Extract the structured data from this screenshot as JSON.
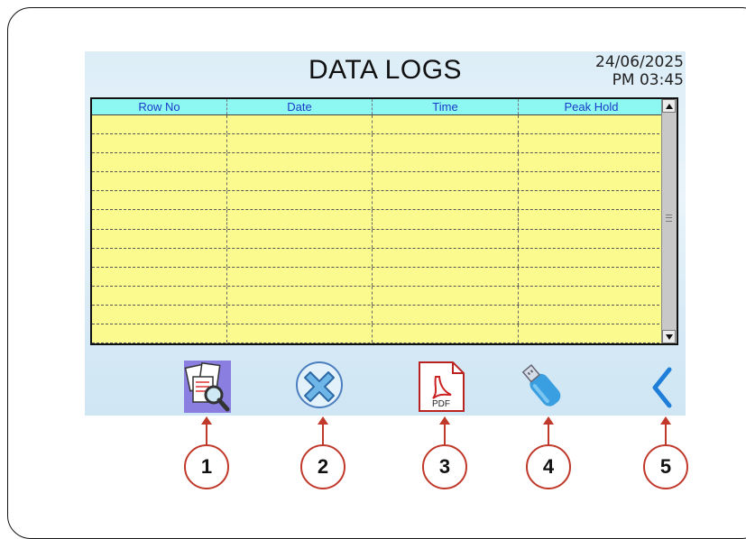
{
  "screen": {
    "title": "DATA LOGS",
    "date": "24/06/2025",
    "time": "PM 03:45"
  },
  "table": {
    "columns": [
      "Row No",
      "Date",
      "Time",
      "Peak Hold"
    ],
    "rows": 12
  },
  "toolbar": {
    "buttons": [
      {
        "name": "search-logs-icon"
      },
      {
        "name": "clear-icon"
      },
      {
        "name": "pdf-icon"
      },
      {
        "name": "usb-icon"
      },
      {
        "name": "back-icon"
      }
    ]
  },
  "callouts": [
    "1",
    "2",
    "3",
    "4",
    "5"
  ],
  "colors": {
    "header_bg": "#8df7f2",
    "row_bg": "#fafa8e",
    "header_text": "#1a3cc8",
    "callout": "#c0392b"
  }
}
